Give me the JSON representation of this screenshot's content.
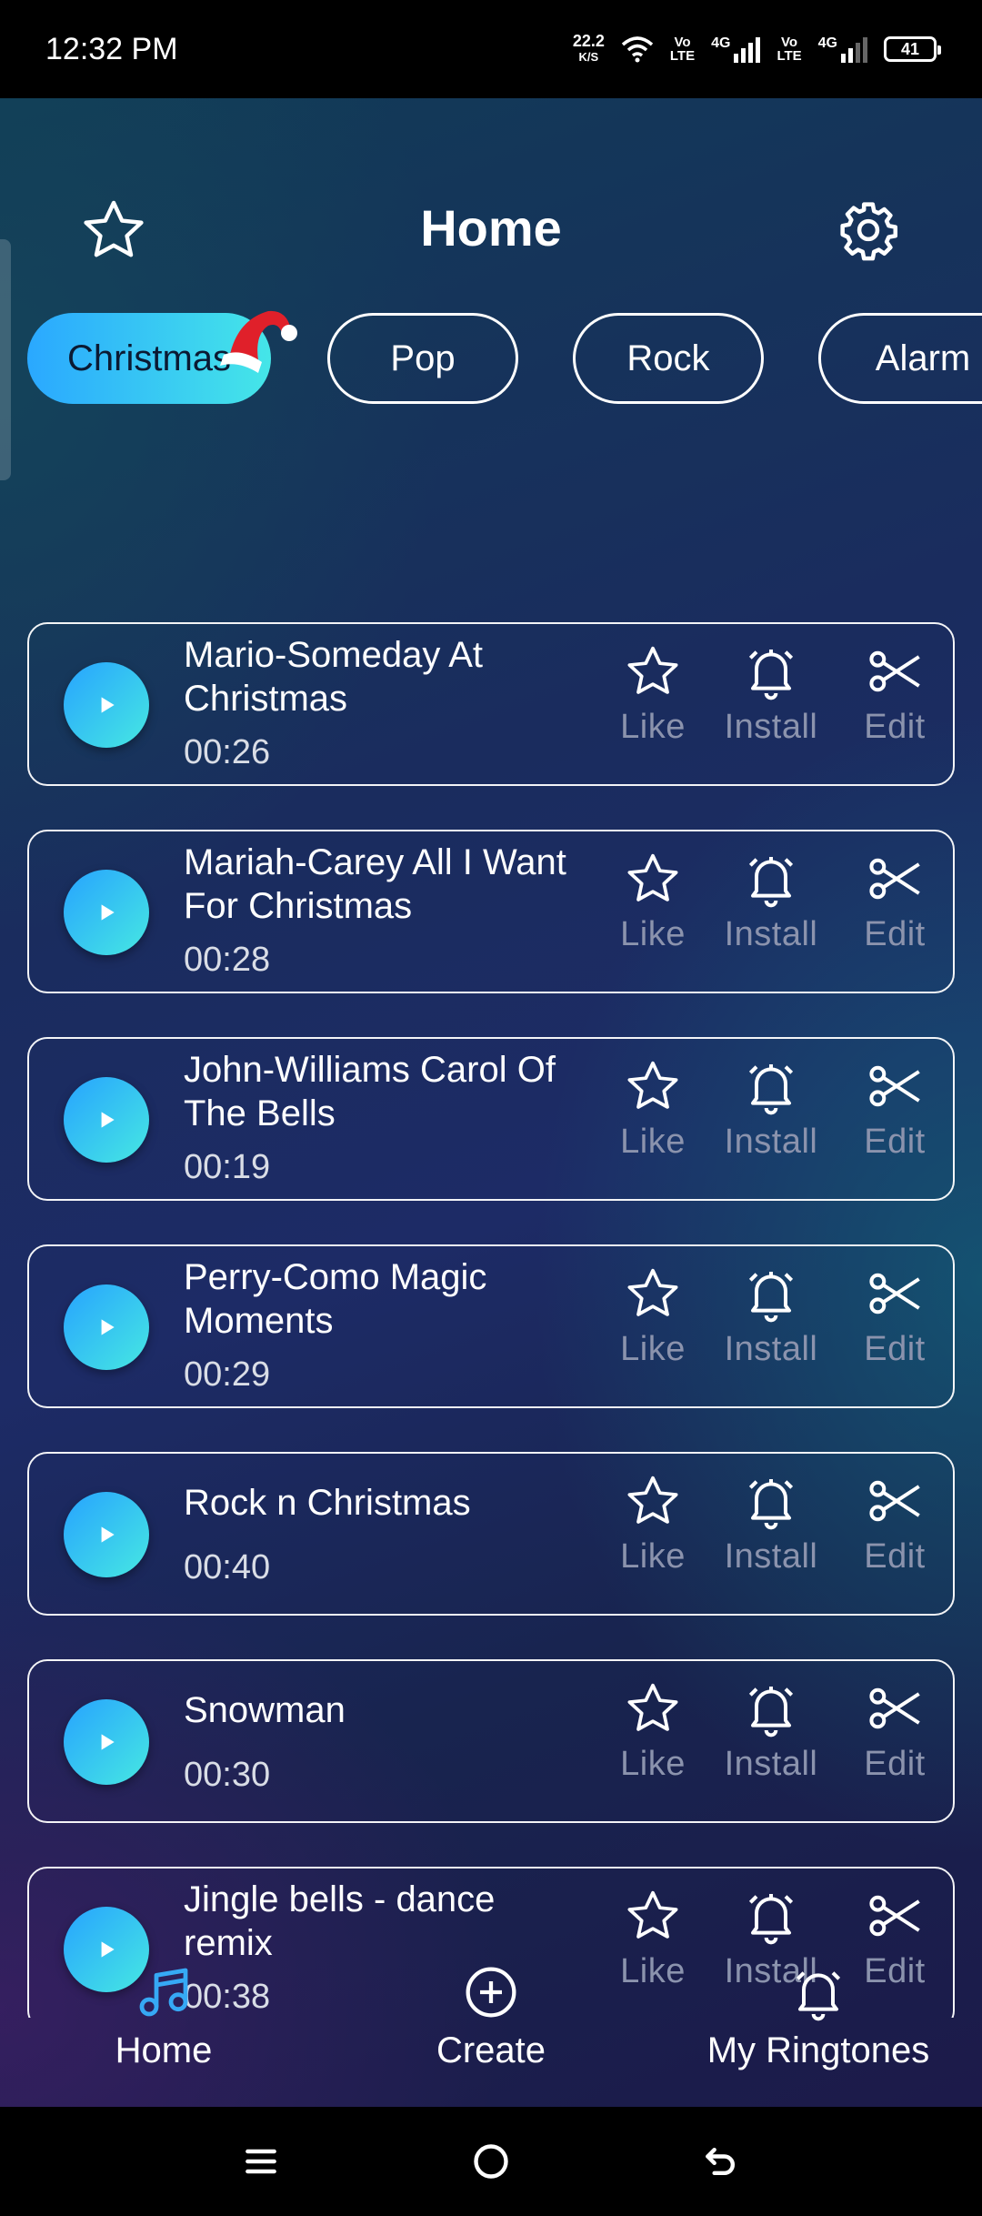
{
  "status_bar": {
    "time": "12:32 PM",
    "net_speed": "22.2",
    "net_unit": "K/S",
    "volte1": "Vo\nLTE",
    "net1": "4G",
    "volte2": "Vo\nLTE",
    "net2": "4G",
    "battery": "41"
  },
  "header": {
    "title": "Home",
    "left_icon": "star-icon",
    "right_icon": "gear-icon"
  },
  "categories": [
    {
      "label": "Christmas",
      "active": true
    },
    {
      "label": "Pop",
      "active": false
    },
    {
      "label": "Rock",
      "active": false
    },
    {
      "label": "Alarm",
      "active": false
    }
  ],
  "actions": {
    "like": "Like",
    "install": "Install",
    "edit": "Edit"
  },
  "songs": [
    {
      "title": "Mario-Someday At Christmas",
      "duration": "00:26"
    },
    {
      "title": "Mariah-Carey All I Want For Christmas",
      "duration": "00:28"
    },
    {
      "title": "John-Williams Carol Of The Bells",
      "duration": "00:19"
    },
    {
      "title": "Perry-Como Magic Moments",
      "duration": "00:29"
    },
    {
      "title": "Rock n Christmas",
      "duration": "00:40"
    },
    {
      "title": "Snowman",
      "duration": "00:30"
    },
    {
      "title": "Jingle bells - dance remix",
      "duration": "00:38"
    }
  ],
  "bottom_nav": [
    {
      "label": "Home",
      "icon": "music-note-icon",
      "active": true,
      "color": "#36a9f5"
    },
    {
      "label": "Create",
      "icon": "plus-circle-icon",
      "active": false
    },
    {
      "label": "My Ringtones",
      "icon": "bell-icon",
      "active": false
    }
  ],
  "colors": {
    "accent_start": "#2aa8ff",
    "accent_end": "#45e6e8",
    "muted_label": "#8b93ad"
  }
}
